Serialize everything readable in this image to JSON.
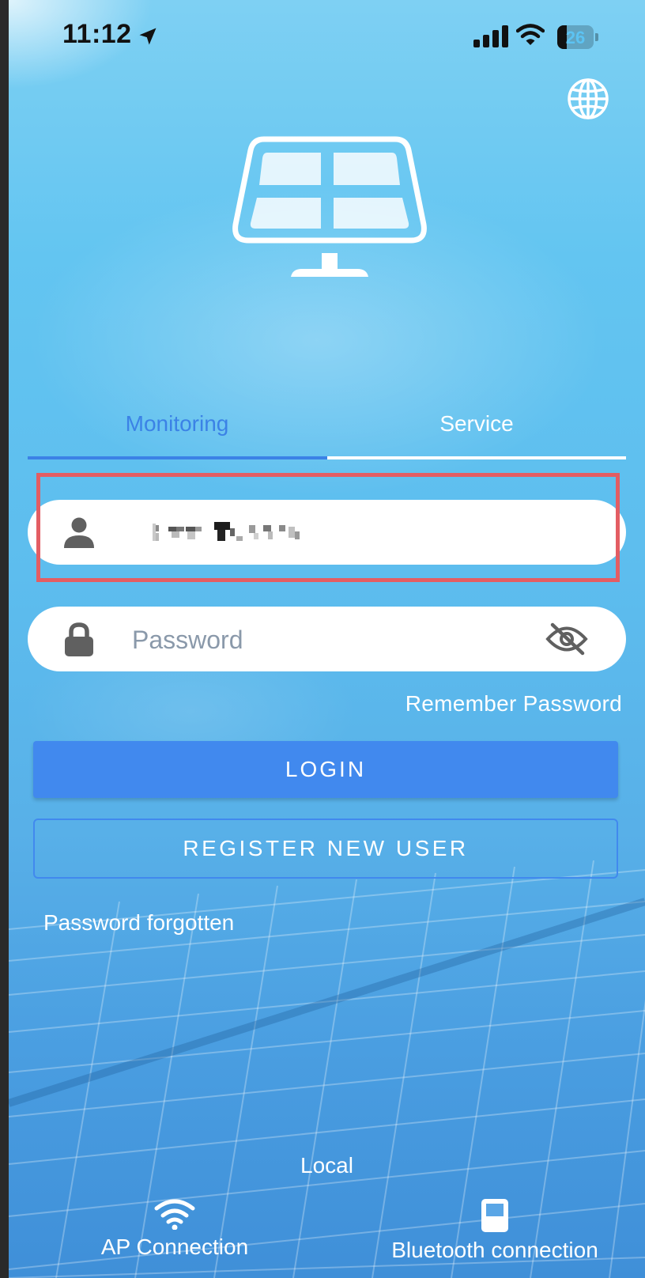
{
  "status_bar": {
    "time": "11:12",
    "battery_level": "26",
    "icons": [
      "location-arrow-icon",
      "cellular-signal-icon",
      "wifi-icon",
      "battery-icon"
    ]
  },
  "header": {
    "language_icon": "globe-icon"
  },
  "logo_icon": "solar-panel-icon",
  "tabs": [
    {
      "label": "Monitoring",
      "active": true
    },
    {
      "label": "Service",
      "active": false
    }
  ],
  "username_field": {
    "icon": "user-icon",
    "value": ""
  },
  "password_field": {
    "icon": "lock-icon",
    "placeholder": "Password",
    "toggle_icon": "eye-slash-icon"
  },
  "remember_password_label": "Remember Password",
  "login_button_label": "LOGIN",
  "register_button_label": "REGISTER NEW USER",
  "password_forgotten_label": "Password forgotten",
  "footer": {
    "local_label": "Local",
    "items": [
      {
        "label": "AP Connection",
        "icon": "wifi-icon"
      },
      {
        "label": "Bluetooth connection",
        "icon": "bluetooth-device-icon"
      }
    ]
  },
  "colors": {
    "accent": "#4189ee",
    "active_tab": "#3b82e6",
    "highlight_box": "#e35d63",
    "background_top": "#7ed0f3",
    "background_bottom": "#3f8fd8"
  }
}
